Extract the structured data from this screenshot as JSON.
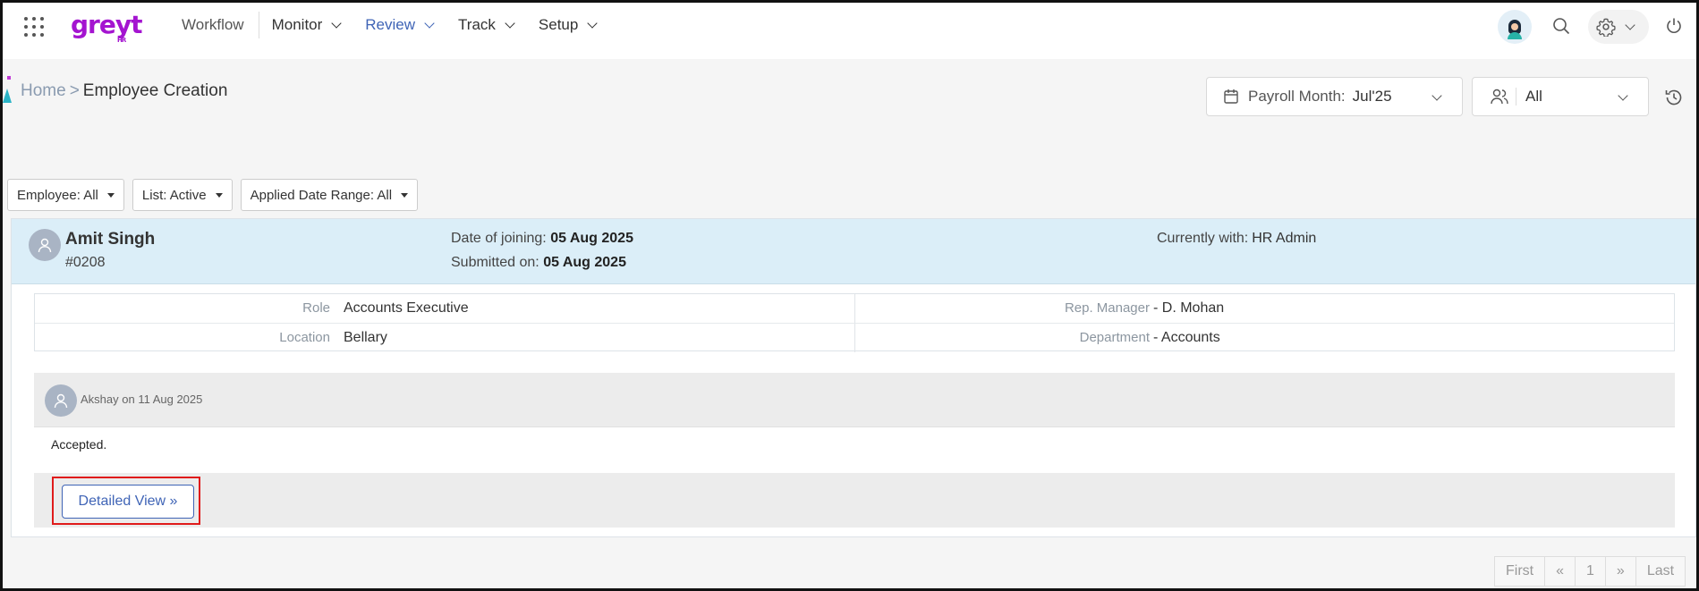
{
  "nav": {
    "items": [
      {
        "label": "Workflow"
      },
      {
        "label": "Monitor"
      },
      {
        "label": "Review"
      },
      {
        "label": "Track"
      },
      {
        "label": "Setup"
      }
    ]
  },
  "brand": {
    "logo_text": "greyt",
    "logo_sub": "HR",
    "accent": "#a414d0",
    "active_nav": "#3f64b6"
  },
  "breadcrumb": {
    "home": "Home",
    "separator": ">",
    "current": "Employee Creation"
  },
  "payroll": {
    "label": "Payroll Month:",
    "value": "Jul'25"
  },
  "group_filter": {
    "value": "All"
  },
  "filters": [
    {
      "label": "Employee: All"
    },
    {
      "label": "List: Active"
    },
    {
      "label": "Applied Date Range: All"
    }
  ],
  "employee": {
    "name": "Amit Singh",
    "id": "#0208",
    "doj_label": "Date of joining:",
    "doj": "05 Aug 2025",
    "submitted_label": "Submitted on:",
    "submitted": "05 Aug 2025",
    "currently_label": "Currently with:",
    "currently": "HR Admin"
  },
  "details": {
    "role_label": "Role",
    "role": "Accounts Executive",
    "manager_label": "Rep. Manager",
    "manager": "- D. Mohan",
    "location_label": "Location",
    "location": "Bellary",
    "department_label": "Department",
    "department": "- Accounts"
  },
  "comment": {
    "meta": "Akshay on 11 Aug 2025",
    "text": "Accepted."
  },
  "actions": {
    "detailed_view": "Detailed View »"
  },
  "pager": {
    "first": "First",
    "prev": "«",
    "page": "1",
    "next": "»",
    "last": "Last"
  }
}
